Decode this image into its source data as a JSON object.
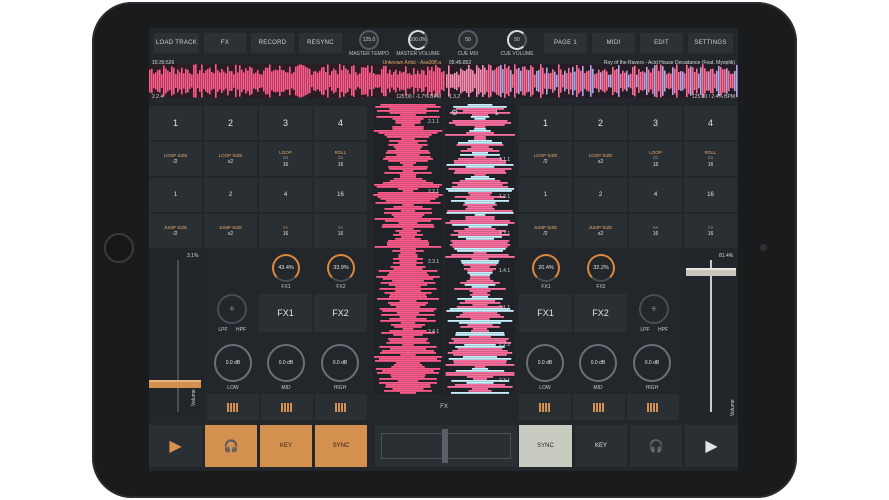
{
  "toolbar": {
    "load_track": "LOAD TRACK",
    "fx": "FX",
    "record": "RECORD",
    "resync": "RESYNC",
    "page": "PAGE 1",
    "midi": "MIDI",
    "edit": "EDIT",
    "settings": "SETTINGS"
  },
  "knobs": {
    "master_tempo": {
      "value": "125.0",
      "label": "MASTER TEMPO"
    },
    "master_volume": {
      "value": "100.0%",
      "label": "MASTER VOLUME"
    },
    "cue_mix": {
      "value": "50",
      "label": "CUE MIX"
    },
    "cue_volume": {
      "value": "50",
      "label": "CUE VOLUME"
    }
  },
  "deck_left": {
    "time": "15:35:526",
    "track": "Unknown Artist - Asa00ff.a",
    "pos": "2.2.4",
    "bpm": "125.00 / -1.7% BPM",
    "volume_value": "3.1%",
    "fx1_value": "43.4%",
    "fx2_value": "33.9%",
    "fx_label1": "FX1",
    "fx_label2": "FX2",
    "filter_value": "-|-",
    "lpf": "LPF",
    "hpf": "HPF",
    "low": "0.0 dB",
    "mid": "0.0 dB",
    "high": "0.0 dB"
  },
  "deck_right": {
    "time": "05:45.852",
    "track": "Roy of the Ravers - Acid House Decadance (Feat. Myoptik)",
    "pos": "1.3.2",
    "bpm": "125.00 / 2.4% BPM",
    "volume_value": "81.4%",
    "fx1_value": "20.4%",
    "fx2_value": "32.2%",
    "filter_value": "-|-",
    "low": "0.0 dB",
    "mid": "0.0 dB",
    "high": "0.0 dB"
  },
  "pads": {
    "hotcues": [
      "1",
      "2",
      "3",
      "4"
    ],
    "loop_size_label": "LOOP SIZE",
    "loop_label": "LOOP",
    "roll_label": "ROLL",
    "half": "/2",
    "double": "x2",
    "sixteen": "16",
    "loop_row": [
      "1",
      "2",
      "4",
      "16"
    ],
    "jump_size_label": "JUMP SIZE",
    "back": "<<",
    "fwd": ">>"
  },
  "eq_labels": {
    "low": "LOW",
    "mid": "MID",
    "high": "HIGH"
  },
  "volume_label": "Volume",
  "center": {
    "fx_label": "FX",
    "markers_left": [
      "2.1.1",
      "2.2.1",
      "2.3.1",
      "2.4.1"
    ],
    "markers_right": [
      "1.1.1",
      "1.2.1",
      "1.3.1",
      "1.4.1",
      "2.1.1",
      "2.2.1",
      "2.3.1"
    ]
  },
  "bottom": {
    "key": "KEY",
    "sync": "SYNC"
  },
  "colors": {
    "accent_orange": "#d9904f",
    "waveform_pink": "#ff5a8a",
    "sync_active": "#c8ccc0"
  }
}
